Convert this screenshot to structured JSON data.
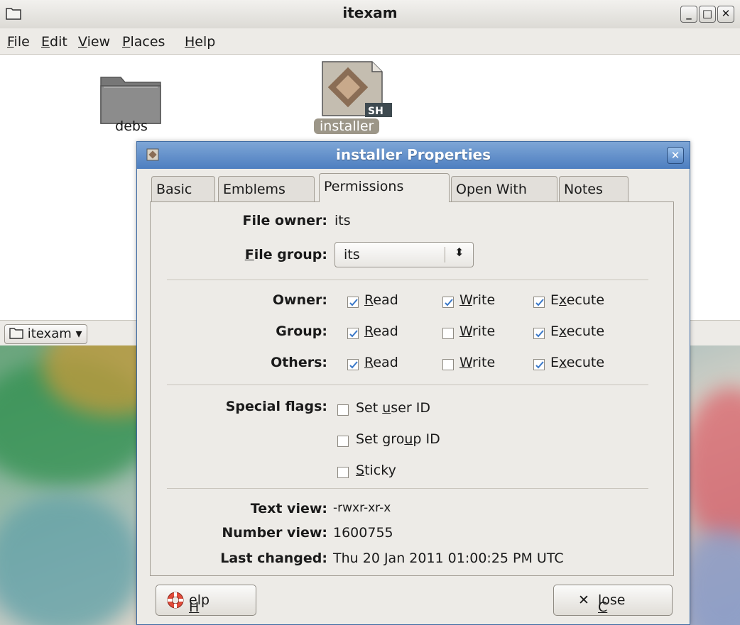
{
  "fm": {
    "title": "itexam",
    "menu": [
      "File",
      "Edit",
      "View",
      "Places",
      "Help"
    ],
    "menu_accel": [
      "F",
      "E",
      "V",
      "P",
      "H"
    ],
    "files": [
      {
        "name": "debs",
        "icon": "folder-icon"
      },
      {
        "name": "installer",
        "icon": "shell-script-icon",
        "selected": true,
        "badge": "SH"
      }
    ],
    "location_button": "itexam"
  },
  "dialog": {
    "title": "installer Properties",
    "tabs": [
      "Basic",
      "Emblems",
      "Permissions",
      "Open With",
      "Notes"
    ],
    "active_tab": "Permissions",
    "file_owner_label": "File owner:",
    "file_owner_value": "its",
    "file_group_label": "File group:",
    "file_group_value": "its",
    "permissions": [
      {
        "who": "Owner:",
        "read": true,
        "write": true,
        "execute": true
      },
      {
        "who": "Group:",
        "read": true,
        "write": false,
        "execute": true
      },
      {
        "who": "Others:",
        "read": true,
        "write": false,
        "execute": true
      }
    ],
    "perm_labels": {
      "read": "Read",
      "write": "Write",
      "execute": "Execute"
    },
    "special_flags_label": "Special flags:",
    "special_flags": [
      {
        "label": "Set user ID",
        "checked": false
      },
      {
        "label": "Set group ID",
        "checked": false
      },
      {
        "label": "Sticky",
        "checked": false
      }
    ],
    "text_view_label": "Text view:",
    "text_view_value": "-rwxr-xr-x",
    "number_view_label": "Number view:",
    "number_view_value": "1600755",
    "last_changed_label": "Last changed:",
    "last_changed_value": "Thu 20 Jan 2011 01:00:25 PM UTC",
    "help_button": "Help",
    "close_button": "Close"
  },
  "colors": {
    "dialog_title": "#4d7ec0",
    "check": "#3a78c8"
  }
}
